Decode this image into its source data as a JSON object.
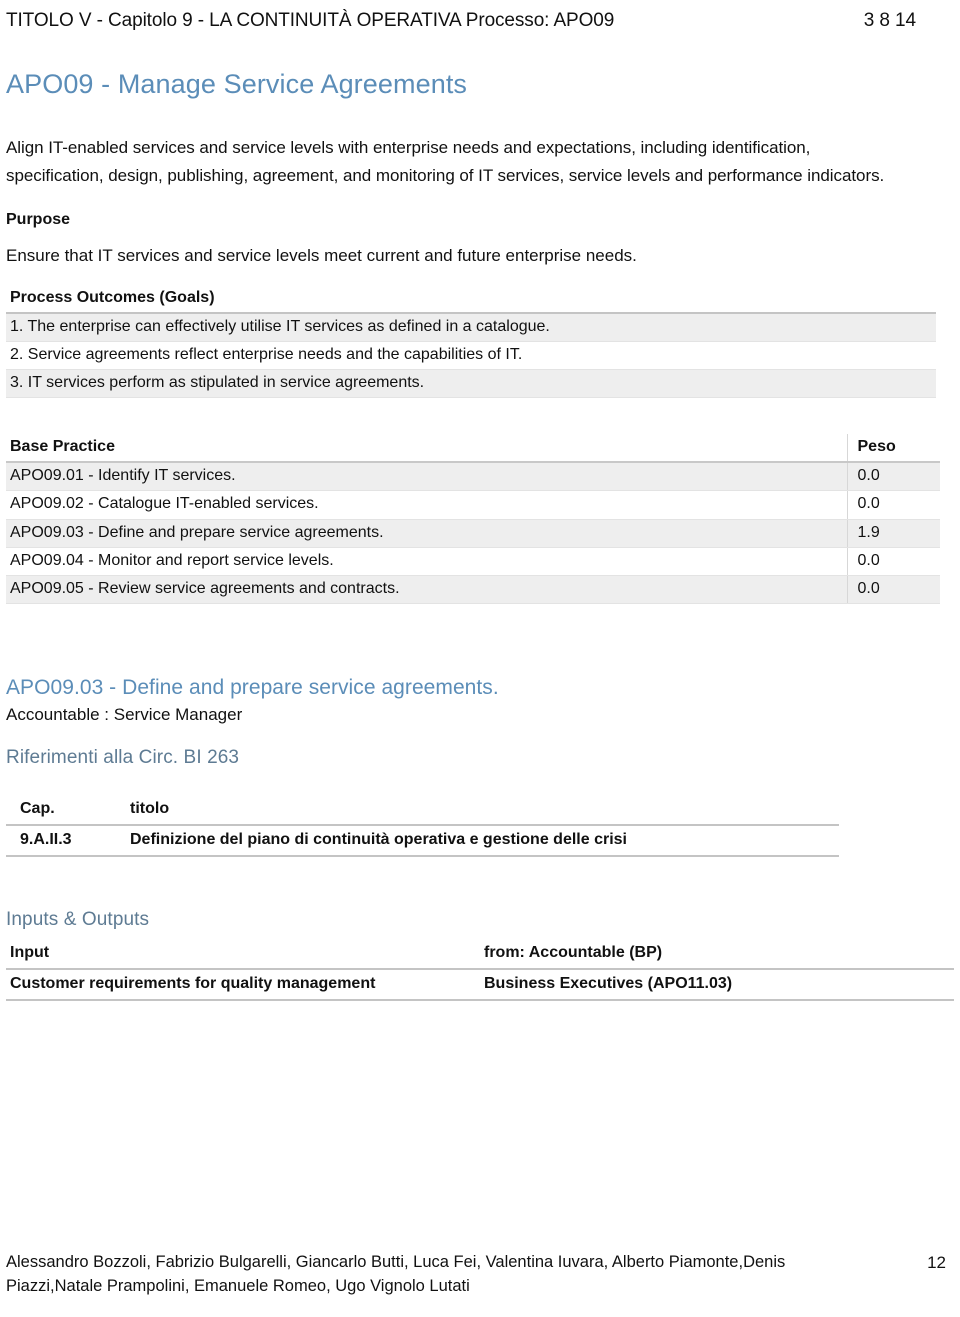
{
  "header": {
    "left": "TITOLO V - Capitolo 9 - LA CONTINUITÀ OPERATIVA  Processo: APO09",
    "right": "3 8 14"
  },
  "process": {
    "title": "APO09 - Manage Service Agreements",
    "description": "Align IT-enabled services and service levels with enterprise needs and expectations, including identification, specification, design, publishing, agreement, and monitoring of IT services, service levels and performance indicators.",
    "purpose_label": "Purpose",
    "purpose_text": "Ensure that IT services and service levels meet current and future enterprise needs."
  },
  "outcomes": {
    "header": "Process Outcomes (Goals)",
    "items": [
      "1. The enterprise can effectively utilise IT services as defined in a catalogue.",
      "2. Service agreements reflect enterprise needs and the capabilities of IT.",
      "3. IT services perform as stipulated in service agreements."
    ]
  },
  "base_practice": {
    "col_name": "Base Practice",
    "col_peso": "Peso",
    "rows": [
      {
        "name": "APO09.01 - Identify IT services.",
        "peso": "0.0"
      },
      {
        "name": "APO09.02 - Catalogue IT-enabled services.",
        "peso": "0.0"
      },
      {
        "name": "APO09.03 - Define and prepare service agreements.",
        "peso": "1.9"
      },
      {
        "name": "APO09.04 - Monitor and report service levels.",
        "peso": "0.0"
      },
      {
        "name": "APO09.05 - Review service agreements and contracts.",
        "peso": "0.0"
      }
    ]
  },
  "subpractice": {
    "title": "APO09.03 - Define and prepare service agreements.",
    "accountable": "Accountable : Service Manager",
    "riferimenti": "Riferimenti alla Circ. BI 263",
    "cap_table": {
      "col_cap": "Cap.",
      "col_titolo": "titolo",
      "rows": [
        {
          "cap": "9.A.II.3",
          "titolo": "Definizione del piano di continuità operativa e gestione delle crisi"
        }
      ]
    }
  },
  "inputs_outputs": {
    "title": "Inputs & Outputs",
    "col_input": "Input",
    "col_from": "from: Accountable (BP)",
    "rows": [
      {
        "input": "Customer requirements for quality management",
        "from": "Business Executives (APO11.03)"
      }
    ]
  },
  "footer": {
    "authors": "Alessandro Bozzoli, Fabrizio Bulgarelli, Giancarlo Butti, Luca Fei, Valentina Iuvara, Alberto Piamonte,Denis Piazzi,Natale Prampolini, Emanuele Romeo, Ugo Vignolo Lutati",
    "page": "12"
  }
}
